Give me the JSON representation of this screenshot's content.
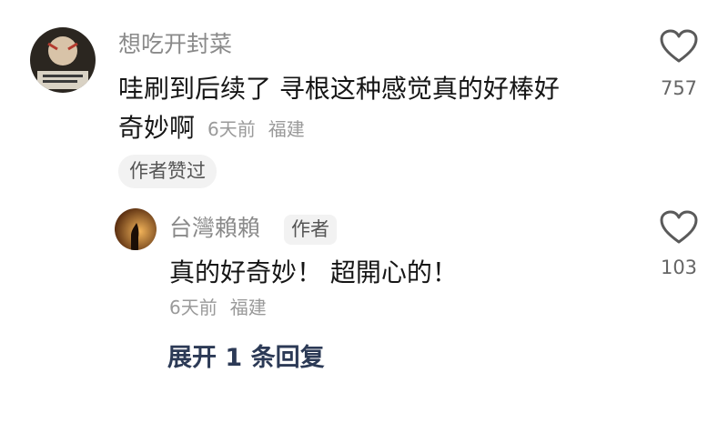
{
  "comment": {
    "username": "想吃开封菜",
    "text_line1": "哇刷到后续了 寻根这种感觉真的好棒好",
    "text_line2": "奇妙啊",
    "time": "6天前",
    "location": "福建",
    "liked_badge": "作者赞过",
    "likes": "757",
    "heart_icon": "heart-outline-icon"
  },
  "reply": {
    "username": "台灣賴賴",
    "author_tag": "作者",
    "text": "真的好奇妙！ 超開心的！",
    "time": "6天前",
    "location": "福建",
    "likes": "103",
    "heart_icon": "heart-outline-icon"
  },
  "expand_replies": "展开 1 条回复",
  "colors": {
    "username": "#8a8a8a",
    "text": "#161616",
    "meta": "#9a9a9a",
    "badge_bg": "#f2f2f2",
    "link": "#2c3a56",
    "icon": "#5a5a5a"
  }
}
